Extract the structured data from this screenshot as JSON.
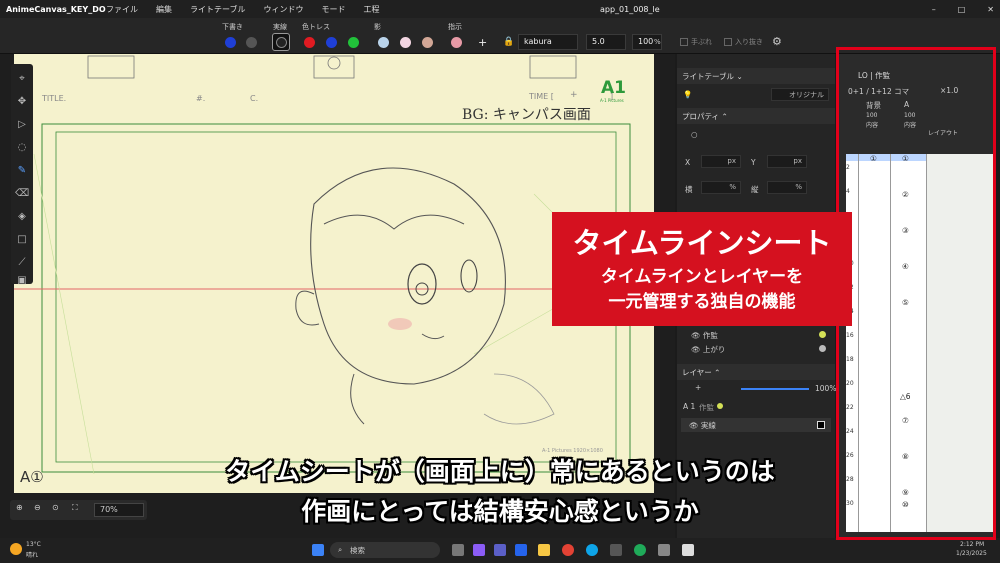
{
  "window": {
    "app_title": "AnimeCanvas_KEY_DO",
    "menu": [
      "ファイル",
      "編集",
      "ライトテーブル",
      "ウィンドウ",
      "モード",
      "工程"
    ],
    "document_title": "app_01_008_le",
    "buttons": [
      "–",
      "□",
      "✕"
    ]
  },
  "toolbar": {
    "groups": {
      "shita": "下書き",
      "jissen": "実線",
      "iro": "色トレス",
      "kage": "影",
      "shiji": "指示"
    },
    "brush_name": "kabura",
    "brush_size": "5.0",
    "opacity": "100",
    "opacity_unit": "%",
    "check_tebure": "手ぶれ",
    "check_irinuki": "入り抜き",
    "plus": "+",
    "colors": [
      "#1f3fd6",
      "#555555",
      "#222222",
      "#e01b22",
      "#1f3fd6",
      "#21c23a",
      "#b9d3ea",
      "#f2d6e2",
      "#d2a796",
      "#e79aa6"
    ]
  },
  "paper": {
    "title_label": "TITLE.",
    "hash_label": "#.",
    "c_label": "C.",
    "time_label": "TIME [",
    "time_plus": "+",
    "time_close": "]",
    "bg_note": "BG: キャンパス画面",
    "logo": "A1",
    "logo_sub": "A-1 Pictures",
    "cut_mark": "A①",
    "corner_note": "A-1 Pictures 1920×1080"
  },
  "zoom": {
    "value": "70%"
  },
  "panel": {
    "light_table": "ライトテーブル",
    "original": "オリジナル",
    "properties": "プロパティ",
    "x_label": "X",
    "y_label": "Y",
    "w_label": "横",
    "h_label": "縦",
    "px": "px",
    "pct": "%",
    "layer_sakkan": "作監",
    "layer_agari": "上がり",
    "layers_header": "レイヤー",
    "layer_opacity": "100%",
    "layer_group": "A 1",
    "layer_group_name": "作監",
    "layer_jissen": "実線"
  },
  "timesheet": {
    "tab": "LO | 作監",
    "frame_info": "0+1 / 1+12 コマ",
    "speed": "×1.0",
    "col_bg": "背景",
    "col_a": "A",
    "vals": "100",
    "naiyou": "内容",
    "layout": "レイアウト",
    "frames": [
      "2",
      "4",
      "6",
      "8",
      "10",
      "12",
      "14",
      "16",
      "18",
      "20",
      "22",
      "24",
      "26",
      "28",
      "30"
    ],
    "bg_cell": "①",
    "a_cells": [
      "①",
      "②",
      "③",
      "④",
      "⑤",
      "△6",
      "⑦",
      "⑧",
      "⑨",
      "⑩"
    ]
  },
  "banner": {
    "title": "タイムラインシート",
    "line1": "タイムラインとレイヤーを",
    "line2": "一元管理する独自の機能"
  },
  "subtitle": {
    "line1": "タイムシートが（画面上に）常にあるというのは",
    "line2": "作画にとっては結構安心感というか"
  },
  "taskbar": {
    "weather_temp": "13°C",
    "weather_desc": "晴れ",
    "search": "検索",
    "time": "2:12 PM",
    "date": "1/23/2025"
  }
}
